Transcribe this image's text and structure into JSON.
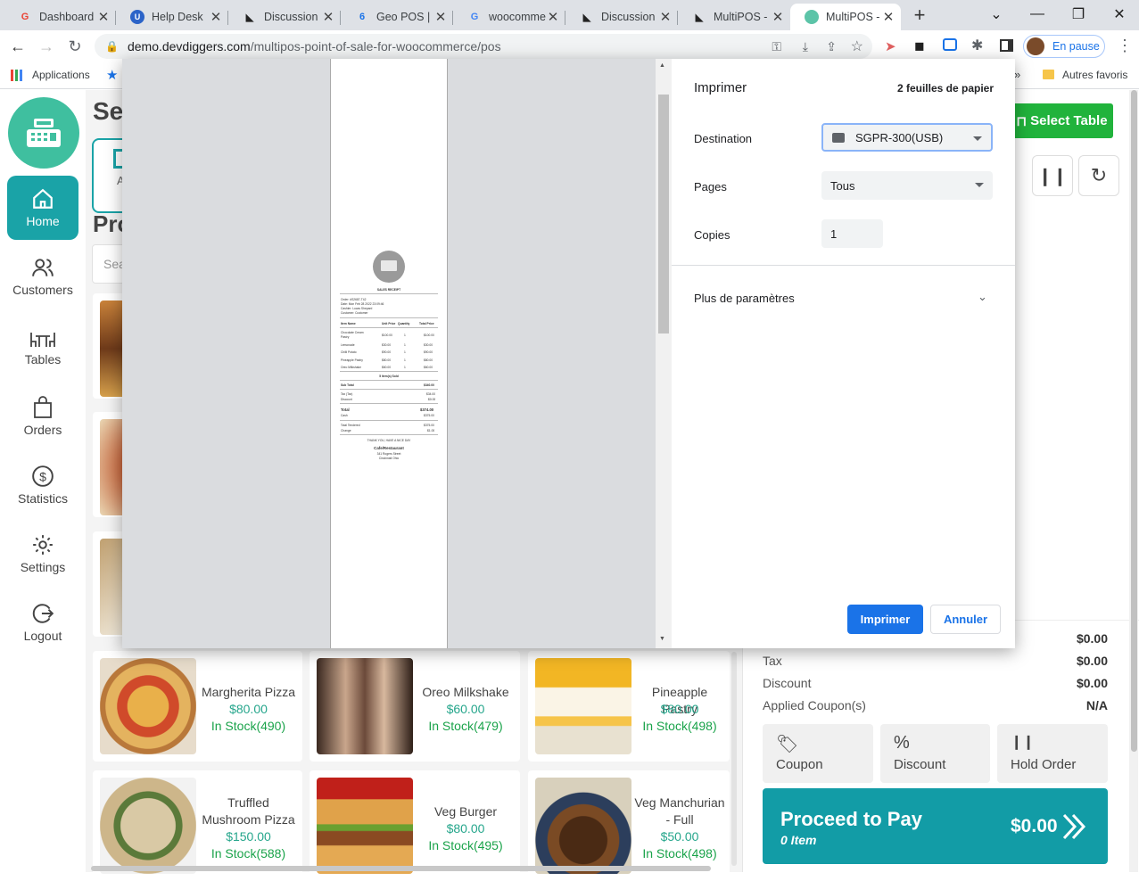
{
  "browser": {
    "tabs": [
      {
        "title": "Dashboard",
        "icon": "gmail-icon"
      },
      {
        "title": "Help Desk",
        "icon": "helpdesk-icon"
      },
      {
        "title": "Discussion",
        "icon": "discussion-icon"
      },
      {
        "title": "Geo POS | D",
        "icon": "geopos-icon"
      },
      {
        "title": "woocomme",
        "icon": "google-icon"
      },
      {
        "title": "Discussion",
        "icon": "discussion-icon"
      },
      {
        "title": "MultiPOS -",
        "icon": "discussion-icon"
      },
      {
        "title": "MultiPOS -",
        "icon": "multipos-icon"
      }
    ],
    "url_host": "demo.devdiggers.com",
    "url_path": "/multipos-point-of-sale-for-woocommerce/pos",
    "profile_label": "En pause",
    "bookmarks": {
      "apps_label": "Applications",
      "other_label": "Autres favoris",
      "more_label": "»"
    }
  },
  "sidebar": {
    "items": [
      {
        "label": "Home",
        "icon": "home-icon"
      },
      {
        "label": "Customers",
        "icon": "customers-icon"
      },
      {
        "label": "Tables",
        "icon": "tables-icon"
      },
      {
        "label": "Orders",
        "icon": "orders-icon"
      },
      {
        "label": "Statistics",
        "icon": "statistics-icon"
      },
      {
        "label": "Settings",
        "icon": "settings-icon"
      },
      {
        "label": "Logout",
        "icon": "logout-icon"
      }
    ]
  },
  "main": {
    "heading_partial": "Sel",
    "products_heading_partial": "Pro",
    "search_placeholder_partial": "Sea",
    "category_label_partial": "A",
    "products": [
      {
        "name": "Margherita Pizza",
        "price": "$80.00",
        "stock": "In Stock(490)"
      },
      {
        "name": "Oreo Milkshake",
        "price": "$60.00",
        "stock": "In Stock(479)"
      },
      {
        "name": "Pineapple Pastry",
        "price": "$80.00",
        "stock": "In Stock(498)"
      },
      {
        "name": "Truffled Mushroom Pizza",
        "price": "$150.00",
        "stock": "In Stock(588)"
      },
      {
        "name": "Veg Burger",
        "price": "$80.00",
        "stock": "In Stock(495)"
      },
      {
        "name": "Veg Manchurian - Full",
        "price": "$50.00",
        "stock": "In Stock(498)"
      }
    ]
  },
  "cart": {
    "select_table_label": "Select Table",
    "summary": [
      {
        "label": "",
        "value": "$0.00"
      },
      {
        "label": "Tax",
        "value": "$0.00"
      },
      {
        "label": "Discount",
        "value": "$0.00"
      },
      {
        "label": "Applied Coupon(s)",
        "value": "N/A"
      }
    ],
    "actions": {
      "coupon": "Coupon",
      "discount": "Discount",
      "hold": "Hold Order"
    },
    "proceed": {
      "label": "Proceed to Pay",
      "items": "0 Item",
      "total": "$0.00"
    }
  },
  "print_dialog": {
    "title": "Imprimer",
    "sheets": "2 feuilles de papier",
    "destination_label": "Destination",
    "destination_value": "SGPR-300(USB)",
    "pages_label": "Pages",
    "pages_value": "Tous",
    "copies_label": "Copies",
    "copies_value": "1",
    "more_settings": "Plus de paramètres",
    "print_button": "Imprimer",
    "cancel_button": "Annuler"
  },
  "receipt": {
    "title": "SALES RECEIPT",
    "meta": [
      "Order: #S2687-T42",
      "Date: Mon Feb 28 2022 23:09:46",
      "Cashier: Lucas Shepard",
      "Customer: Customer"
    ],
    "headers": [
      "Item Name",
      "Unit Price",
      "Quantity",
      "Total Price"
    ],
    "items": [
      [
        "Chocolate Cream",
        "$100.00",
        "1",
        "$100.00"
      ],
      [
        "Pastry",
        "",
        "",
        ""
      ],
      [
        "Lemonade",
        "$30.00",
        "1",
        "$30.00"
      ],
      [
        "Chilli Potato",
        "$90.00",
        "1",
        "$90.00"
      ],
      [
        "Pineapple Pastry",
        "$80.00",
        "1",
        "$80.00"
      ],
      [
        "Oreo Milkshake",
        "$60.00",
        "1",
        "$60.00"
      ]
    ],
    "sold": "5 Item(s) Sold",
    "subtotal": [
      "Sub Total",
      "$340.00"
    ],
    "tax": [
      "Tax (Tax)",
      "$34.00"
    ],
    "discount": [
      "Discount",
      "$0.00"
    ],
    "total": [
      "Total",
      "$374.00"
    ],
    "cash": [
      "Cash",
      "$375.00"
    ],
    "tendered": [
      "Total Tendered",
      "$375.00"
    ],
    "change": [
      "Change",
      "$1.00"
    ],
    "thanks": "THANK YOU, HAVE A NICE DAY",
    "store": "Cafe/Restaurant",
    "address1": "341 Rogers Street",
    "address2": "Cincinnati Ohio"
  }
}
